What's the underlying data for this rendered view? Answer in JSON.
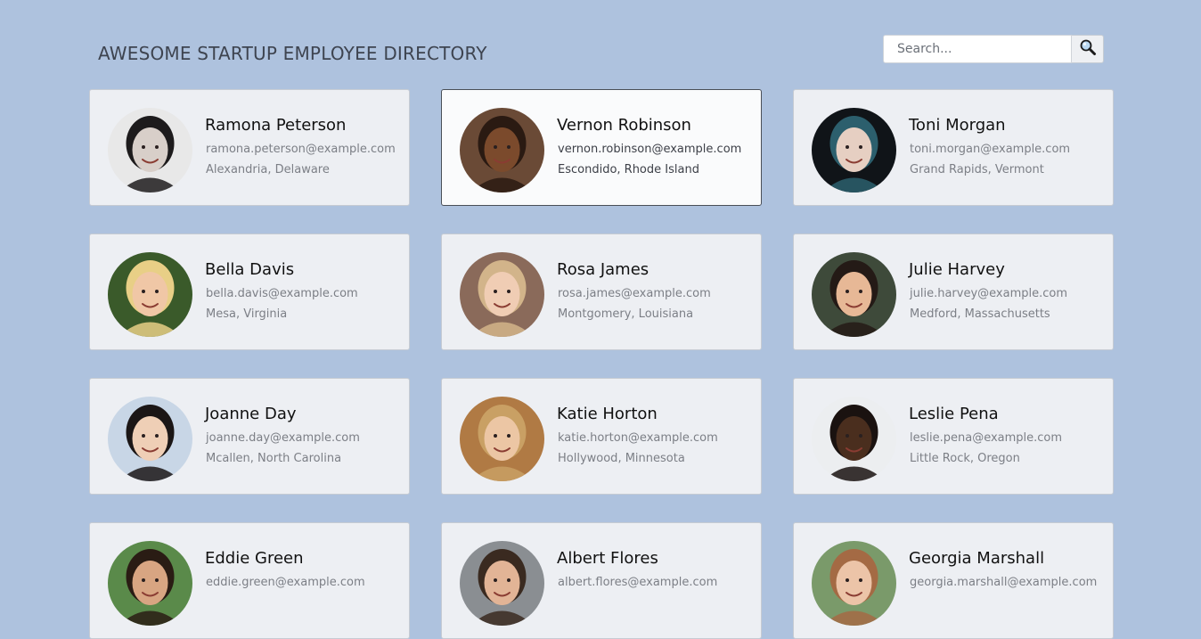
{
  "header": {
    "title": "AWESOME STARTUP EMPLOYEE DIRECTORY"
  },
  "search": {
    "placeholder": "Search...",
    "button_icon": "magnifier-icon"
  },
  "colors": {
    "background": "#aec2de",
    "card": "#edeff3",
    "card_active": "#fafbfc",
    "active_border": "#4a4f57"
  },
  "employees": [
    {
      "name": "Ramona Peterson",
      "email": "ramona.peterson@example.com",
      "location": "Alexandria, Delaware",
      "active": false,
      "avatar": {
        "bg": "#e8e8e8",
        "skin": "#d8cfc9",
        "hair": "#1d1b1c"
      }
    },
    {
      "name": "Vernon Robinson",
      "email": "vernon.robinson@example.com",
      "location": "Escondido, Rhode Island",
      "active": true,
      "avatar": {
        "bg": "#6a4a36",
        "skin": "#7b4a2c",
        "hair": "#2a1a12"
      }
    },
    {
      "name": "Toni Morgan",
      "email": "toni.morgan@example.com",
      "location": "Grand Rapids, Vermont",
      "active": false,
      "avatar": {
        "bg": "#101418",
        "skin": "#e6cfc2",
        "hair": "#2c5f6d"
      }
    },
    {
      "name": "Bella Davis",
      "email": "bella.davis@example.com",
      "location": "Mesa, Virginia",
      "active": false,
      "avatar": {
        "bg": "#3a5a2a",
        "skin": "#f0c7a6",
        "hair": "#e8cf86"
      }
    },
    {
      "name": "Rosa James",
      "email": "rosa.james@example.com",
      "location": "Montgomery, Louisiana",
      "active": false,
      "avatar": {
        "bg": "#8a6a5a",
        "skin": "#f0cdb4",
        "hair": "#d2b48a"
      }
    },
    {
      "name": "Julie Harvey",
      "email": "julie.harvey@example.com",
      "location": "Medford, Massachusetts",
      "active": false,
      "avatar": {
        "bg": "#3e4a3a",
        "skin": "#e7b896",
        "hair": "#241a16"
      }
    },
    {
      "name": "Joanne Day",
      "email": "joanne.day@example.com",
      "location": "Mcallen, North Carolina",
      "active": false,
      "avatar": {
        "bg": "#c8d6e6",
        "skin": "#efcfb6",
        "hair": "#1b1616"
      }
    },
    {
      "name": "Katie Horton",
      "email": "katie.horton@example.com",
      "location": "Hollywood, Minnesota",
      "active": false,
      "avatar": {
        "bg": "#b07a44",
        "skin": "#ecc6a4",
        "hair": "#c9a064"
      }
    },
    {
      "name": "Leslie Pena",
      "email": "leslie.pena@example.com",
      "location": "Little Rock, Oregon",
      "active": false,
      "avatar": {
        "bg": "#eceef0",
        "skin": "#4a2e1e",
        "hair": "#1a1210"
      }
    },
    {
      "name": "Eddie Green",
      "email": "eddie.green@example.com",
      "location": "",
      "active": false,
      "avatar": {
        "bg": "#5a8a4a",
        "skin": "#d8a582",
        "hair": "#2a1c14"
      }
    },
    {
      "name": "Albert Flores",
      "email": "albert.flores@example.com",
      "location": "",
      "active": false,
      "avatar": {
        "bg": "#8a8e92",
        "skin": "#e2b496",
        "hair": "#3a2a20"
      }
    },
    {
      "name": "Georgia Marshall",
      "email": "georgia.marshall@example.com",
      "location": "",
      "active": false,
      "avatar": {
        "bg": "#7a9a6a",
        "skin": "#ecc4a8",
        "hair": "#a46a44"
      }
    }
  ]
}
